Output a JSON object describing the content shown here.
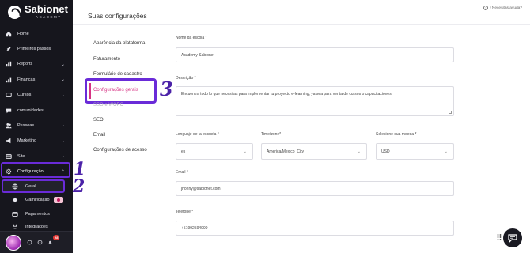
{
  "brand": {
    "name": "Sabionet",
    "tagline": "ACADEMY"
  },
  "sidebar": {
    "items": [
      {
        "label": "Home",
        "icon": "home-icon"
      },
      {
        "label": "Primeiros passos",
        "icon": "rocket-icon"
      },
      {
        "label": "Reports",
        "icon": "chart-icon",
        "chevron": "⌄"
      },
      {
        "label": "Finanças",
        "icon": "finance-icon",
        "chevron": "⌄"
      },
      {
        "label": "Cursos",
        "icon": "course-icon",
        "chevron": "⌄"
      },
      {
        "label": "comunidades",
        "icon": "chat-icon"
      },
      {
        "label": "Pessoas",
        "icon": "people-icon",
        "chevron": "⌄"
      },
      {
        "label": "Marketing",
        "icon": "megaphone-icon",
        "chevron": "⌄"
      },
      {
        "label": "Site",
        "icon": "globe-icon",
        "chevron": "⌄"
      },
      {
        "label": "Configuração",
        "icon": "gear-icon",
        "chevron": "⌃"
      }
    ],
    "sub_items": [
      {
        "label": "Geral",
        "icon": "globe-icon"
      },
      {
        "label": "Gamificação",
        "icon": "gamification-icon"
      },
      {
        "label": "Pagamentos",
        "icon": "card-icon"
      },
      {
        "label": "Integrações",
        "icon": "plug-icon"
      }
    ],
    "notification_count": "28"
  },
  "annotations": {
    "one": "1",
    "two": "2",
    "three": "3"
  },
  "header": {
    "title": "Suas configurações",
    "help": "¿Necesitas ayuda?"
  },
  "settings_nav": [
    "Aparência da plataforma",
    "Faturamento",
    "Formulário de cadastro",
    "Configurações gerais",
    "SSO e WOPO",
    "SEO",
    "Email",
    "Configurações de acesso"
  ],
  "form": {
    "school_name": {
      "label": "Nome da escola *",
      "value": "Academy Sabionet"
    },
    "description": {
      "label": "Descrição *",
      "value": "Encuentra todo lo que necesitas para implementar tu proyecto e-learning, ya sea para venta de cursos o capacitaciones"
    },
    "language": {
      "label": "Lenguaje de la escuela *",
      "value": "es"
    },
    "timezone": {
      "label": "Time/zone*",
      "value": "America/Mexico_City"
    },
    "currency": {
      "label": "Selecione sua moeda *",
      "value": "USD"
    },
    "email": {
      "label": "Email *",
      "value": "jhonny@sabionet.com"
    },
    "phone": {
      "label": "Telefone *",
      "value": "+51992594999"
    }
  },
  "colors": {
    "accent": "#d63384",
    "highlight": "#6a2bd8",
    "sidebar_bg": "#16161d"
  }
}
